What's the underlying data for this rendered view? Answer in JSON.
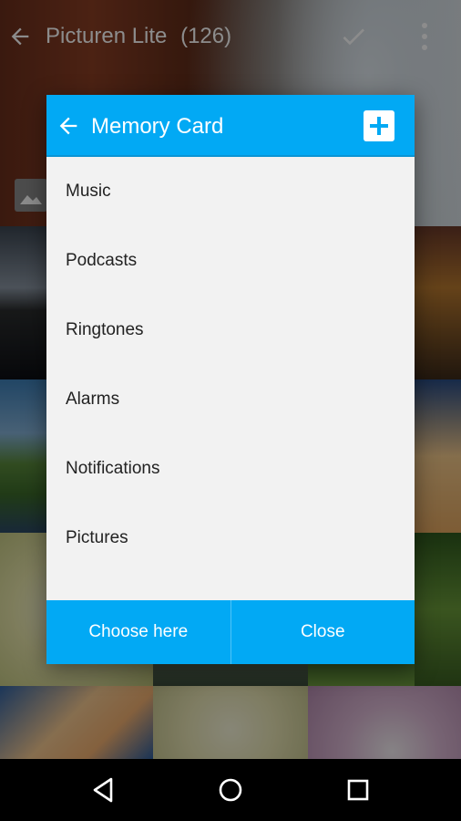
{
  "app": {
    "title": "Picturen Lite",
    "count": "(126)"
  },
  "dialog": {
    "title": "Memory Card",
    "items": [
      "Music",
      "Podcasts",
      "Ringtones",
      "Alarms",
      "Notifications",
      "Pictures"
    ],
    "choose_label": "Choose here",
    "close_label": "Close"
  },
  "colors": {
    "accent": "#02a9f4",
    "dialog_bg": "#f2f2f2",
    "text": "#222222"
  },
  "icons": {
    "app_back": "arrow-left-icon",
    "app_check": "check-icon",
    "app_more": "more-vert-icon",
    "album": "image-icon",
    "dialog_back": "arrow-left-icon",
    "dialog_add": "plus-icon",
    "nav_back": "triangle-back-icon",
    "nav_home": "circle-home-icon",
    "nav_recent": "square-recents-icon"
  }
}
